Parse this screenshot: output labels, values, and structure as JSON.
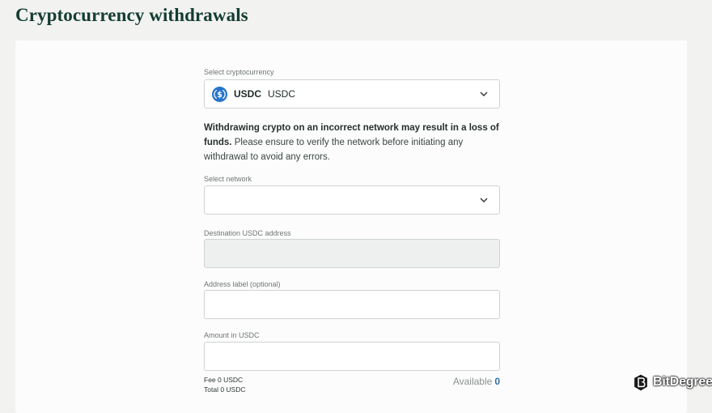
{
  "page": {
    "title": "Cryptocurrency withdrawals"
  },
  "form": {
    "crypto": {
      "label": "Select cryptocurrency",
      "ticker": "USDC",
      "name": "USDC",
      "icon": "usdc-coin-icon",
      "accent": "#2775ca"
    },
    "warning": {
      "bold": "Withdrawing crypto on an incorrect network may result in a loss of funds.",
      "rest": " Please ensure to verify the network before initiating any withdrawal to avoid any errors."
    },
    "network": {
      "label": "Select network",
      "value": ""
    },
    "address": {
      "label": "Destination USDC address",
      "value": ""
    },
    "address_label": {
      "label": "Address label (optional)",
      "value": ""
    },
    "amount": {
      "label": "Amount in USDC",
      "value": ""
    },
    "summary": {
      "fee": "Fee 0 USDC",
      "total": "Total 0 USDC",
      "available_label": "Available",
      "available_value": "0"
    }
  },
  "watermark": {
    "text": "BitDegree"
  },
  "colors": {
    "title": "#133d32",
    "background": "#f2f2f1",
    "card": "#fcfcfc",
    "link": "#2f6fa6"
  }
}
